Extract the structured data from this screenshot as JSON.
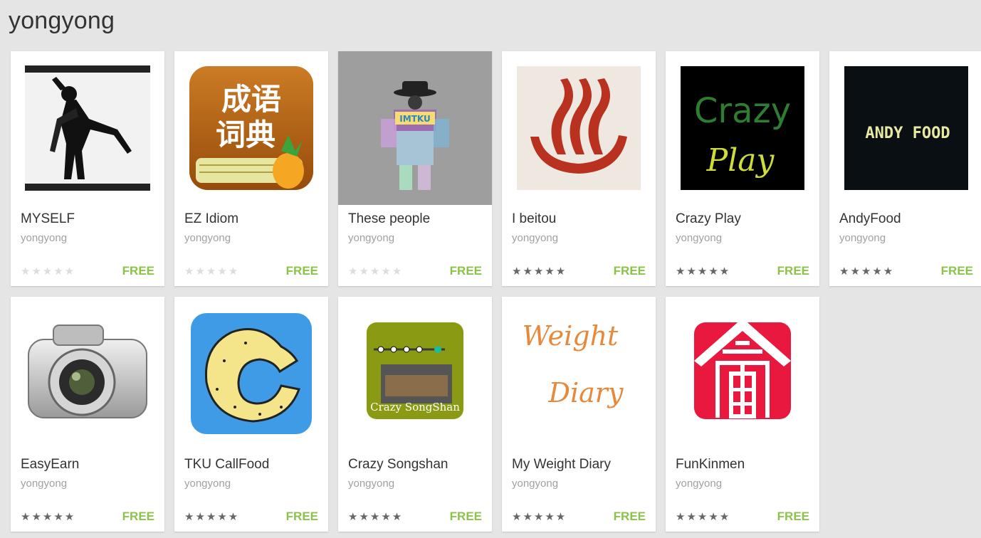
{
  "developer_name": "yongyong",
  "price_color": "#8bc34a",
  "apps": [
    {
      "title": "MYSELF",
      "developer": "yongyong",
      "price": "FREE",
      "stars": "★★★★★",
      "rated": false,
      "icon": "silhouette-photo-icon"
    },
    {
      "title": "EZ Idiom",
      "developer": "yongyong",
      "price": "FREE",
      "stars": "★★★★★",
      "rated": false,
      "icon": "idiom-book-icon",
      "icon_text": [
        "成语",
        "词典"
      ]
    },
    {
      "title": "These people",
      "developer": "yongyong",
      "price": "FREE",
      "stars": "★★★★★",
      "rated": false,
      "icon": "hat-figure-icon",
      "icon_text": [
        "IMTKU"
      ]
    },
    {
      "title": "I beitou",
      "developer": "yongyong",
      "price": "FREE",
      "stars": "★★★★★",
      "rated": true,
      "icon": "hot-spring-icon"
    },
    {
      "title": "Crazy Play",
      "developer": "yongyong",
      "price": "FREE",
      "stars": "★★★★★",
      "rated": true,
      "icon": "crazy-play-icon",
      "icon_text": [
        "Crazy",
        "Play"
      ]
    },
    {
      "title": "AndyFood",
      "developer": "yongyong",
      "price": "FREE",
      "stars": "★★★★★",
      "rated": true,
      "icon": "andy-food-icon",
      "icon_text": [
        "ANDY FOOD"
      ]
    },
    {
      "title": "EasyEarn",
      "developer": "yongyong",
      "price": "FREE",
      "stars": "★★★★★",
      "rated": true,
      "icon": "camera-icon"
    },
    {
      "title": "TKU CallFood",
      "developer": "yongyong",
      "price": "FREE",
      "stars": "★★★★★",
      "rated": true,
      "icon": "cookie-icon"
    },
    {
      "title": "Crazy Songshan",
      "developer": "yongyong",
      "price": "FREE",
      "stars": "★★★★★",
      "rated": true,
      "icon": "metro-station-icon",
      "icon_text": [
        "Crazy SongShan"
      ]
    },
    {
      "title": "My Weight Diary",
      "developer": "yongyong",
      "price": "FREE",
      "stars": "★★★★★",
      "rated": true,
      "icon": "weight-diary-icon",
      "icon_text": [
        "Weight",
        "Diary"
      ]
    },
    {
      "title": "FunKinmen",
      "developer": "yongyong",
      "price": "FREE",
      "stars": "★★★★★",
      "rated": true,
      "icon": "kinmen-gate-icon"
    }
  ]
}
